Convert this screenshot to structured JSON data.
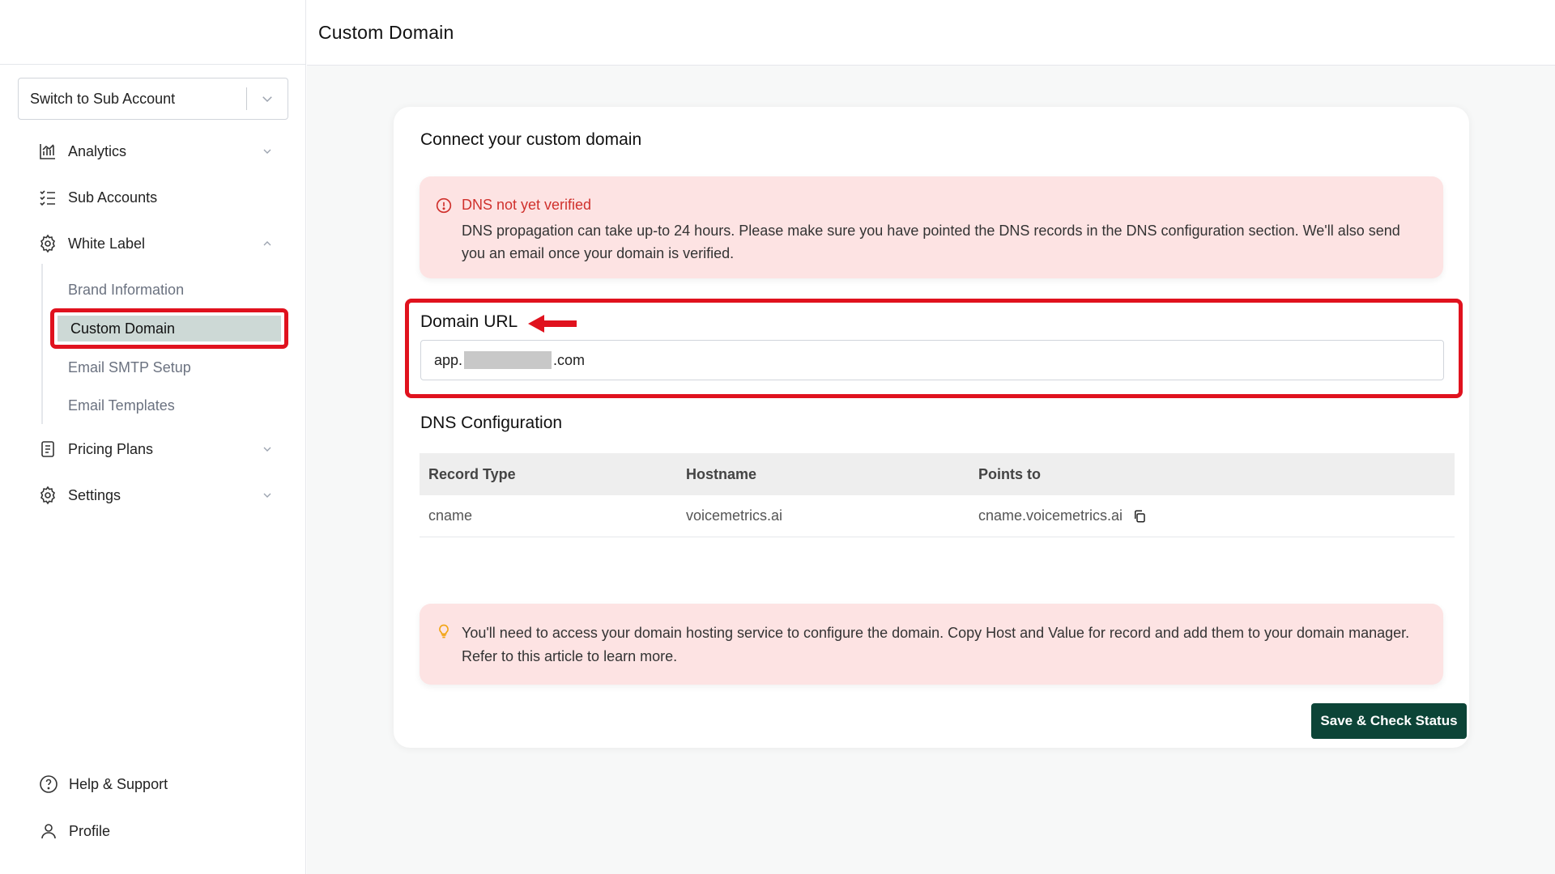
{
  "header": {
    "title": "Custom Domain"
  },
  "sidebar": {
    "switch_account": "Switch to Sub Account",
    "items": [
      {
        "label": "Analytics"
      },
      {
        "label": "Sub Accounts"
      },
      {
        "label": "White Label"
      },
      {
        "label": "Pricing Plans"
      },
      {
        "label": "Settings"
      }
    ],
    "white_label_sub": [
      {
        "label": "Brand Information"
      },
      {
        "label": "Custom Domain"
      },
      {
        "label": "Email SMTP Setup"
      },
      {
        "label": "Email Templates"
      }
    ],
    "bottom": [
      {
        "label": "Help & Support"
      },
      {
        "label": "Profile"
      }
    ]
  },
  "card": {
    "title": "Connect your custom domain",
    "dns_alert": {
      "title": "DNS not yet verified",
      "body": "DNS propagation can take up-to 24 hours. Please make sure you have pointed the DNS records in the DNS configuration section. We'll also send you an email once your domain is verified."
    },
    "domain": {
      "label": "Domain URL",
      "value_prefix": "app.",
      "value_suffix": ".com"
    },
    "dns_config": {
      "title": "DNS Configuration",
      "headers": [
        "Record Type",
        "Hostname",
        "Points to"
      ],
      "rows": [
        {
          "record_type": "cname",
          "hostname": "voicemetrics.ai",
          "points_to": "cname.voicemetrics.ai"
        }
      ]
    },
    "tip_alert": {
      "body": "You'll need to access your domain hosting service to configure the domain. Copy Host and Value for record and add them to your domain manager. Refer to this article to learn more."
    },
    "save_button": "Save & Check Status"
  },
  "colors": {
    "accent_dark_green": "#0c4437",
    "highlight_red": "#e0121e",
    "alert_bg": "#fde3e3",
    "alert_title": "#d0312d",
    "active_sub_bg": "#cdd9d6"
  }
}
